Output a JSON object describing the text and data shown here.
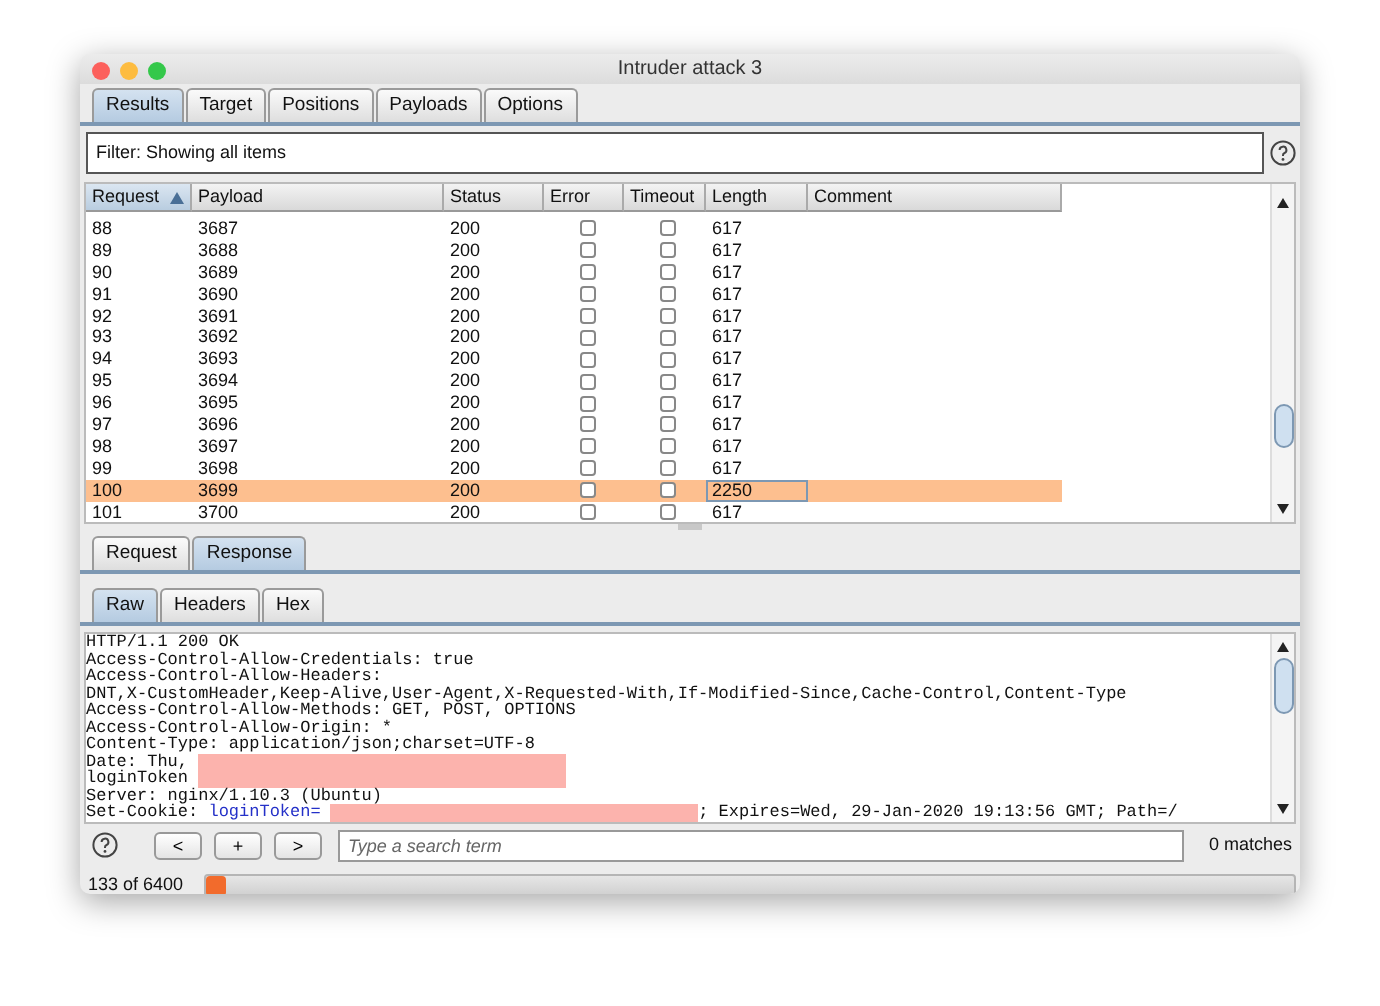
{
  "window": {
    "title": "Intruder attack 3"
  },
  "tabs": [
    {
      "label": "Results",
      "selected": true
    },
    {
      "label": "Target",
      "selected": false
    },
    {
      "label": "Positions",
      "selected": false
    },
    {
      "label": "Payloads",
      "selected": false
    },
    {
      "label": "Options",
      "selected": false
    }
  ],
  "filter": {
    "text": "Filter: Showing all items"
  },
  "table": {
    "columns": [
      {
        "label": "Request",
        "sorted": true
      },
      {
        "label": "Payload",
        "sorted": false
      },
      {
        "label": "Status",
        "sorted": false
      },
      {
        "label": "Error",
        "sorted": false
      },
      {
        "label": "Timeout",
        "sorted": false
      },
      {
        "label": "Length",
        "sorted": false
      },
      {
        "label": "Comment",
        "sorted": false
      }
    ],
    "rows": [
      {
        "request": "88",
        "payload": "3687",
        "status": "200",
        "error": false,
        "timeout": false,
        "length": "617",
        "selected": false
      },
      {
        "request": "89",
        "payload": "3688",
        "status": "200",
        "error": false,
        "timeout": false,
        "length": "617",
        "selected": false
      },
      {
        "request": "90",
        "payload": "3689",
        "status": "200",
        "error": false,
        "timeout": false,
        "length": "617",
        "selected": false
      },
      {
        "request": "91",
        "payload": "3690",
        "status": "200",
        "error": false,
        "timeout": false,
        "length": "617",
        "selected": false
      },
      {
        "request": "92",
        "payload": "3691",
        "status": "200",
        "error": false,
        "timeout": false,
        "length": "617",
        "selected": false
      },
      {
        "request": "93",
        "payload": "3692",
        "status": "200",
        "error": false,
        "timeout": false,
        "length": "617",
        "selected": false
      },
      {
        "request": "94",
        "payload": "3693",
        "status": "200",
        "error": false,
        "timeout": false,
        "length": "617",
        "selected": false
      },
      {
        "request": "95",
        "payload": "3694",
        "status": "200",
        "error": false,
        "timeout": false,
        "length": "617",
        "selected": false
      },
      {
        "request": "96",
        "payload": "3695",
        "status": "200",
        "error": false,
        "timeout": false,
        "length": "617",
        "selected": false
      },
      {
        "request": "97",
        "payload": "3696",
        "status": "200",
        "error": false,
        "timeout": false,
        "length": "617",
        "selected": false
      },
      {
        "request": "98",
        "payload": "3697",
        "status": "200",
        "error": false,
        "timeout": false,
        "length": "617",
        "selected": false
      },
      {
        "request": "99",
        "payload": "3698",
        "status": "200",
        "error": false,
        "timeout": false,
        "length": "617",
        "selected": false
      },
      {
        "request": "100",
        "payload": "3699",
        "status": "200",
        "error": false,
        "timeout": false,
        "length": "2250",
        "selected": true
      },
      {
        "request": "101",
        "payload": "3700",
        "status": "200",
        "error": false,
        "timeout": false,
        "length": "617",
        "selected": false
      }
    ]
  },
  "message_tabs": [
    {
      "label": "Request",
      "selected": false
    },
    {
      "label": "Response",
      "selected": true
    }
  ],
  "view_tabs": [
    {
      "label": "Raw",
      "selected": true
    },
    {
      "label": "Headers",
      "selected": false
    },
    {
      "label": "Hex",
      "selected": false
    }
  ],
  "response_lines": [
    [
      {
        "kind": "plain",
        "text": "HTTP/1.1 200 OK"
      }
    ],
    [
      {
        "kind": "plain",
        "text": "Access-Control-Allow-Credentials: true"
      }
    ],
    [
      {
        "kind": "plain",
        "text": "Access-Control-Allow-Headers:"
      }
    ],
    [
      {
        "kind": "plain",
        "text": "DNT,X-CustomHeader,Keep-Alive,User-Agent,X-Requested-With,If-Modified-Since,Cache-Control,Content-Type"
      }
    ],
    [
      {
        "kind": "plain",
        "text": "Access-Control-Allow-Methods: GET, POST, OPTIONS"
      }
    ],
    [
      {
        "kind": "plain",
        "text": "Access-Control-Allow-Origin: *"
      }
    ],
    [
      {
        "kind": "plain",
        "text": "Content-Type: application/json;charset=UTF-8"
      }
    ],
    [
      {
        "kind": "plain",
        "text": "Date: Thu,"
      },
      {
        "kind": "redacted"
      }
    ],
    [
      {
        "kind": "plain",
        "text": "loginToken"
      },
      {
        "kind": "redacted"
      }
    ],
    [
      {
        "kind": "plain",
        "text": "Server: nginx/1.10.3 (Ubuntu)"
      }
    ],
    [
      {
        "kind": "plain",
        "text": "Set-Cookie:"
      },
      {
        "kind": "key",
        "text": "loginToken="
      },
      {
        "kind": "redacted"
      },
      {
        "kind": "plain",
        "text": "; Expires=Wed, 29-Jan-2020 19:13:56 GMT; Path=/"
      }
    ]
  ],
  "search": {
    "buttons": [
      "<",
      "+",
      ">"
    ],
    "placeholder": "Type a search term",
    "matches": "0 matches"
  },
  "progress": {
    "text": "133 of 6400",
    "level": 0.02
  }
}
